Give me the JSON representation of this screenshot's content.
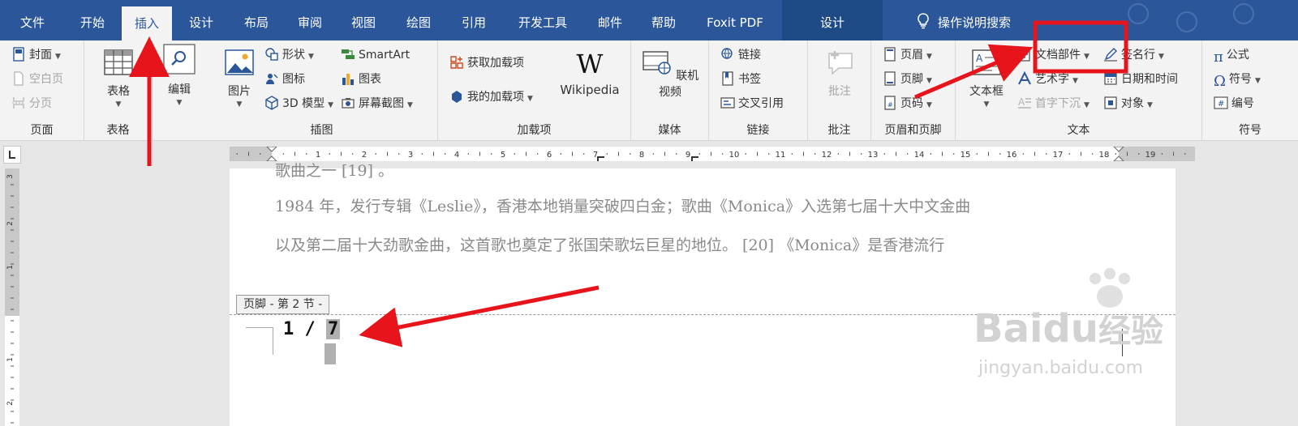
{
  "tabs": [
    {
      "label": "文件",
      "active": false
    },
    {
      "label": "开始",
      "active": false
    },
    {
      "label": "插入",
      "active": true
    },
    {
      "label": "设计",
      "active": false
    },
    {
      "label": "布局",
      "active": false
    },
    {
      "label": "审阅",
      "active": false
    },
    {
      "label": "视图",
      "active": false
    },
    {
      "label": "绘图",
      "active": false
    },
    {
      "label": "引用",
      "active": false
    },
    {
      "label": "开发工具",
      "active": false
    },
    {
      "label": "邮件",
      "active": false
    },
    {
      "label": "帮助",
      "active": false
    },
    {
      "label": "Foxit PDF",
      "active": false
    },
    {
      "label": "设计",
      "active": false,
      "context": true
    }
  ],
  "search_label": "操作说明搜索",
  "groups": {
    "pages": {
      "label": "页面",
      "cover": "封面",
      "blank": "空白页",
      "break": "分页"
    },
    "tables": {
      "label": "表格",
      "table": "表格"
    },
    "editing": {
      "edit": "编辑"
    },
    "illustrations": {
      "label": "插图",
      "picture": "图片",
      "shapes": "形状",
      "icons": "图标",
      "model3d": "3D 模型",
      "smartart": "SmartArt",
      "chart": "图表",
      "screenshot": "屏幕截图"
    },
    "addins": {
      "label": "加载项",
      "get": "获取加载项",
      "mine": "我的加载项",
      "wiki": "Wikipedia"
    },
    "media": {
      "label": "媒体",
      "video": "联机视频"
    },
    "links": {
      "label": "链接",
      "link": "链接",
      "bookmark": "书签",
      "crossref": "交叉引用"
    },
    "comments": {
      "label": "批注",
      "comment": "批注"
    },
    "header_footer": {
      "label": "页眉和页脚",
      "header": "页眉",
      "footer": "页脚",
      "pagenum": "页码"
    },
    "text": {
      "label": "文本",
      "textbox": "文本框",
      "quickparts": "文档部件",
      "wordart": "艺术字",
      "dropcap": "首字下沉",
      "sigline": "签名行",
      "datetime": "日期和时间",
      "object": "对象"
    },
    "symbols": {
      "label": "符号",
      "equation": "公式",
      "symbol": "符号",
      "number": "编号"
    }
  },
  "ruler_numbers": [
    "1",
    "1",
    "2",
    "3",
    "4",
    "5",
    "6",
    "7",
    "8",
    "9",
    "10",
    "11",
    "12",
    "13",
    "14",
    "15",
    "16",
    "17",
    "18",
    "19"
  ],
  "vruler_numbers": [
    "3",
    "2",
    "1",
    "1",
    "2"
  ],
  "document": {
    "line0": "歌曲之一 [19] 。",
    "line1": "1984 年，发行专辑《Leslie》，香港本地销量突破四白金；歌曲《Monica》入选第七届十大中文金曲",
    "line2": "以及第二届十大劲歌金曲，这首歌也奠定了张国荣歌坛巨星的地位。 [20]  《Monica》是香港流行",
    "footer_tag": "页脚 - 第 2 节 -",
    "page_num_prefix": "1 / ",
    "page_num_total": "7"
  },
  "watermark": {
    "brand": "Bai",
    "du": "du",
    "cn": "经验",
    "url": "jingyan.baidu.com"
  },
  "colors": {
    "tabbar": "#2b579a",
    "ribbon": "#f3f3f3",
    "annotation": "#e8141b"
  }
}
